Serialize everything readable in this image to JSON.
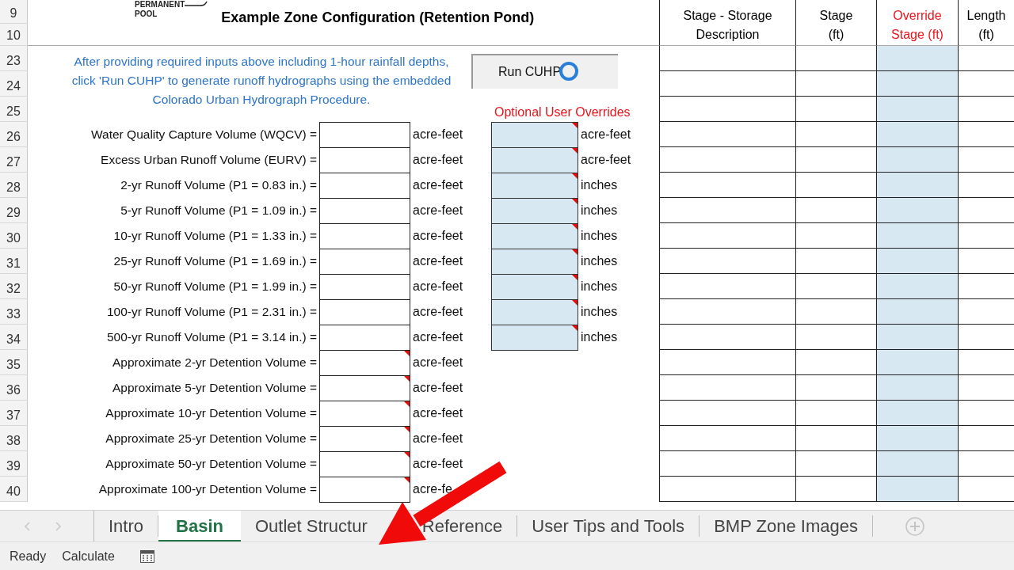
{
  "title_area": {
    "drawing_labels": [
      "PERMANENT",
      "POOL"
    ],
    "title": "Example Zone Configuration (Retention Pond)"
  },
  "instructions": "After providing required inputs above including 1-hour rainfall depths, click 'Run CUHP' to generate runoff hydrographs using the embedded Colorado Urban Hydrograph Procedure.",
  "run_button": {
    "label": "Run CUHP"
  },
  "overrides_heading": "Optional User Overrides",
  "row_numbers": [
    "9",
    "10",
    "23",
    "24",
    "25",
    "26",
    "27",
    "28",
    "29",
    "30",
    "31",
    "32",
    "33",
    "34",
    "35",
    "36",
    "37",
    "38",
    "39",
    "40"
  ],
  "volumes": [
    {
      "label": "Water Quality Capture Volume (WQCV) =",
      "unit": "acre-feet",
      "comment": false,
      "override": {
        "unit": "acre-feet",
        "comment": true
      }
    },
    {
      "label": "Excess Urban Runoff Volume (EURV) =",
      "unit": "acre-feet",
      "comment": false,
      "override": {
        "unit": "acre-feet",
        "comment": true
      }
    },
    {
      "label": "2-yr Runoff Volume (P1 = 0.83 in.) =",
      "unit": "acre-feet",
      "comment": false,
      "override": {
        "unit": "inches",
        "comment": true
      }
    },
    {
      "label": "5-yr Runoff Volume (P1 = 1.09 in.) =",
      "unit": "acre-feet",
      "comment": false,
      "override": {
        "unit": "inches",
        "comment": true
      }
    },
    {
      "label": "10-yr Runoff Volume (P1 = 1.33 in.) =",
      "unit": "acre-feet",
      "comment": false,
      "override": {
        "unit": "inches",
        "comment": true
      }
    },
    {
      "label": "25-yr Runoff Volume (P1 = 1.69 in.) =",
      "unit": "acre-feet",
      "comment": false,
      "override": {
        "unit": "inches",
        "comment": true
      }
    },
    {
      "label": "50-yr Runoff Volume (P1 = 1.99 in.) =",
      "unit": "acre-feet",
      "comment": false,
      "override": {
        "unit": "inches",
        "comment": true
      }
    },
    {
      "label": "100-yr Runoff Volume (P1 = 2.31 in.) =",
      "unit": "acre-feet",
      "comment": false,
      "override": {
        "unit": "inches",
        "comment": true
      }
    },
    {
      "label": "500-yr Runoff Volume (P1 = 3.14 in.) =",
      "unit": "acre-feet",
      "comment": false,
      "override": {
        "unit": "inches",
        "comment": true
      }
    },
    {
      "label": "Approximate 2-yr Detention Volume =",
      "unit": "acre-feet",
      "comment": true
    },
    {
      "label": "Approximate 5-yr Detention Volume =",
      "unit": "acre-feet",
      "comment": true
    },
    {
      "label": "Approximate 10-yr Detention Volume =",
      "unit": "acre-feet",
      "comment": true
    },
    {
      "label": "Approximate 25-yr Detention Volume =",
      "unit": "acre-feet",
      "comment": true
    },
    {
      "label": "Approximate 50-yr Detention Volume =",
      "unit": "acre-feet",
      "comment": true
    },
    {
      "label": "Approximate 100-yr Detention Volume =",
      "unit": "acre-fe",
      "comment": true
    }
  ],
  "stage_table": {
    "columns": [
      {
        "lines": [
          "Stage - Storage",
          "Description"
        ],
        "kind": "label"
      },
      {
        "lines": [
          "Stage",
          "(ft)"
        ],
        "kind": "label"
      },
      {
        "lines": [
          "Override",
          "Stage (ft)"
        ],
        "kind": "override"
      },
      {
        "lines": [
          "Length",
          "(ft)"
        ],
        "kind": "label"
      }
    ]
  },
  "sheet_tabs": [
    {
      "label": "Intro",
      "selected": false
    },
    {
      "label": "Basin",
      "selected": true
    },
    {
      "label": "Outlet Structur",
      "selected": false
    },
    {
      "label": "Reference",
      "selected": false
    },
    {
      "label": "User Tips and Tools",
      "selected": false
    },
    {
      "label": "BMP Zone Images",
      "selected": false
    }
  ],
  "status_bar": {
    "items": [
      "Ready",
      "Calculate"
    ]
  }
}
